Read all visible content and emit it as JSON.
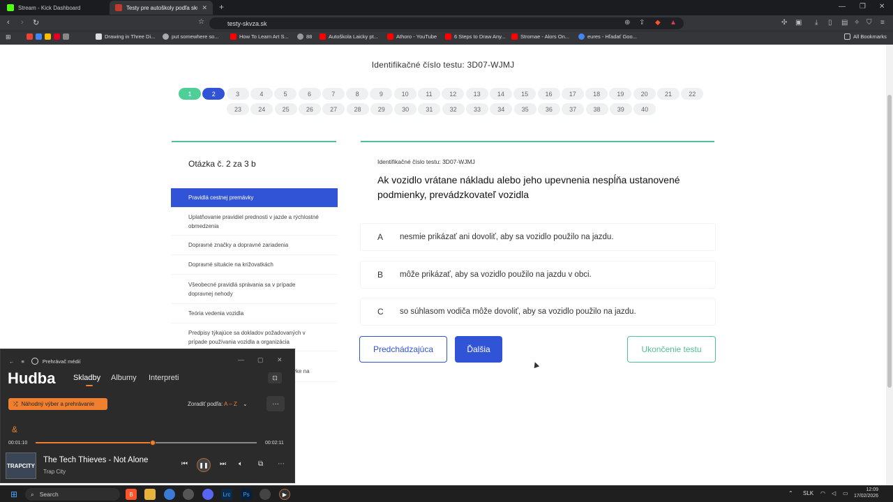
{
  "browser": {
    "tabs": [
      {
        "title": "Stream - Kick Dashboard",
        "active": false
      },
      {
        "title": "Testy pre autoškoly podľa skupín",
        "active": true
      }
    ],
    "url": "testy-skvza.sk",
    "bookmarks": [
      "Drawing in Three Di...",
      "put somewhere so...",
      "How To Learn Art S...",
      "88",
      "Autoškola Laicky pt...",
      "Athoro - YouTube",
      "6 Steps to Draw Any...",
      "Stromae - Alors On...",
      "eures - Hľadať Goo..."
    ],
    "all_bookmarks": "All Bookmarks"
  },
  "page": {
    "test_id_header": "Identifikačné číslo testu: 3D07-WJMJ",
    "pagination": {
      "row1": [
        "1",
        "2",
        "3",
        "4",
        "5",
        "6",
        "7",
        "8",
        "9",
        "10",
        "11",
        "12",
        "13",
        "14",
        "15",
        "16",
        "17",
        "18",
        "19",
        "20",
        "21",
        "22"
      ],
      "row2": [
        "23",
        "24",
        "25",
        "26",
        "27",
        "28",
        "29",
        "30",
        "31",
        "32",
        "33",
        "34",
        "35",
        "36",
        "37",
        "38",
        "39",
        "40"
      ],
      "done": "1",
      "current": "2"
    },
    "question_header": "Otázka č. 2  za  3 b",
    "categories": [
      "Pravidlá cestnej premávky",
      "Uplatňovanie pravidiel prednosti v jazde a rýchlostné obmedzenia",
      "Dopravné značky a dopravné zariadenia",
      "Dopravné situácie na križovatkách",
      "Všeobecné pravidlá správania sa v prípade dopravnej nehody",
      "Teória vedenia vozidla",
      "Predpisy týkajúce sa dokladov požadovaných v prípade používania vozidla a organizácia",
      "vke na"
    ],
    "question_id": "Identifikačné číslo testu:  3D07-WJMJ",
    "question_text": "Ak vozidlo vrátane nákladu alebo jeho upevnenia nespĺňa ustanovené podmienky, prevádzkovateľ vozidla",
    "answers": [
      {
        "letter": "A",
        "text": "nesmie prikázať ani dovoliť, aby sa vozidlo použilo na jazdu."
      },
      {
        "letter": "B",
        "text": "môže prikázať, aby sa vozidlo použilo na jazdu v obci."
      },
      {
        "letter": "C",
        "text": "so súhlasom vodiča môže dovoliť, aby sa vozidlo použilo na jazdu."
      }
    ],
    "btn_prev": "Predchádzajúca",
    "btn_next": "Ďalšia",
    "btn_end": "Ukončenie testu"
  },
  "player": {
    "app_name": "Prehrávač médií",
    "title": "Hudba",
    "tabs": [
      "Skladby",
      "Albumy",
      "Interpreti"
    ],
    "shuffle": "Náhodný výber a prehrávanie",
    "sort_label": "Zoradiť podľa:",
    "sort_value": "A – Z",
    "group_letter": "&",
    "time_current": "00:01:10",
    "time_total": "00:02:11",
    "progress": 0.53,
    "song": "The Tech Thieves - Not Alone",
    "artist": "Trap City",
    "album_art_text": "TRAPCITY"
  },
  "taskbar": {
    "search": "Search",
    "lang": "SLK",
    "time": "12:09",
    "date": "17/02/2026"
  },
  "colors": {
    "accent_blue": "#3154d7",
    "accent_green": "#4fcf97",
    "player_orange": "#f08030"
  }
}
